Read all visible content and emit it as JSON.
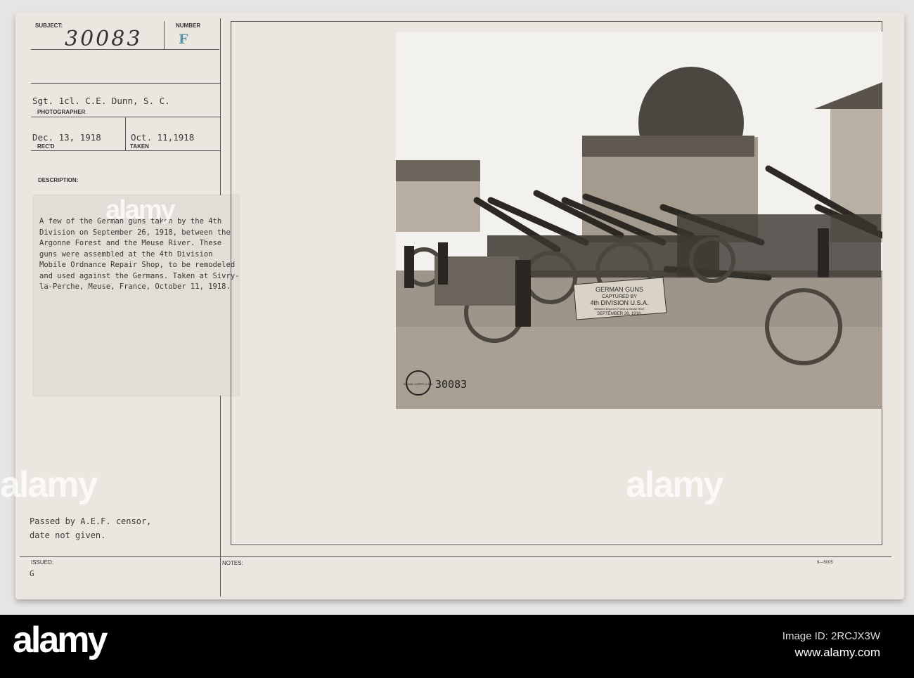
{
  "card": {
    "subject_label": "SUBJECT:",
    "subject_value": "30083",
    "number_label": "NUMBER",
    "number_value": "F",
    "photographer": "Sgt. 1cl. C.E. Dunn, S. C.",
    "photographer_label": "PHOTOGRAPHER",
    "received": "Dec. 13, 1918",
    "received_label": "REC'D",
    "taken": "Oct. 11,1918",
    "taken_label": "TAKEN",
    "description_label": "DESCRIPTION:",
    "description": "A few of the German guns taken by the 4th Division on September 26, 1918, between the Argonne Forest and the Meuse River. These guns were assembled at the 4th Division Mobile Ordnance Repair Shop, to be remodeled and used against the Germans.  Taken at Sivry-la-Perche, Meuse, France, October 11, 1918.",
    "censor": "Passed by A.E.F. censor,",
    "censor2": "date not given.",
    "issued_label": "ISSUED:",
    "issued_value": "G",
    "notes_label": "NOTES:",
    "form_code": "9—5005"
  },
  "photo": {
    "sign_line1": "GERMAN GUNS",
    "sign_line2": "CAPTURED BY",
    "sign_line3": "4th DIVISION U.S.A.",
    "sign_line4": "Between Argonne Forest & Meuse River",
    "sign_line5": "SEPTEMBER 26, 1918.",
    "stamp_text": "SIGNAL CORPS U.S.A.",
    "photo_number": "30083"
  },
  "watermark": {
    "brand": "alamy",
    "image_id": "Image ID: 2RCJX3W",
    "url": "www.alamy.com"
  }
}
